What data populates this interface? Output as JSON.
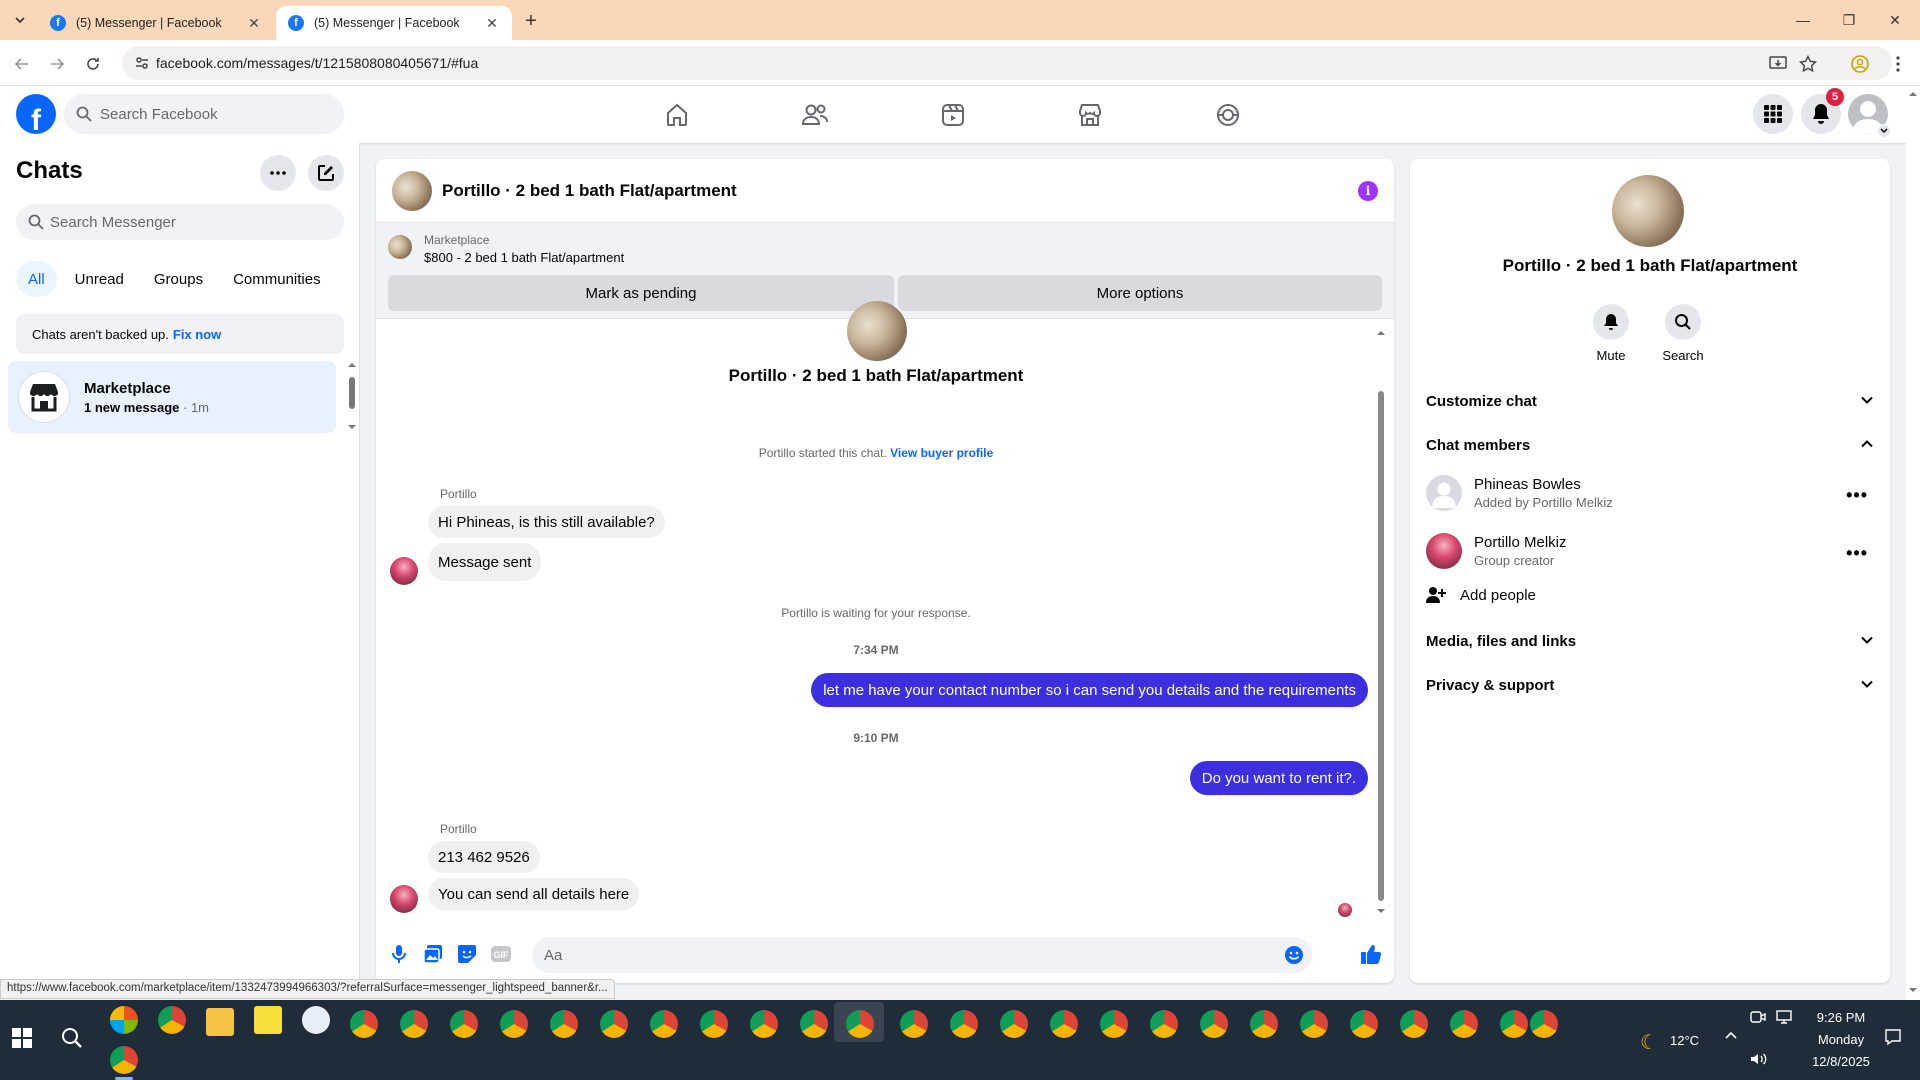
{
  "browser": {
    "tabs": [
      {
        "title": "(5) Messenger | Facebook",
        "favicon": "f"
      },
      {
        "title": "(5) Messenger | Facebook",
        "favicon": "f"
      }
    ],
    "url": "facebook.com/messages/t/1215808080405671/#fua",
    "status_url": "https://www.facebook.com/marketplace/item/1332473994966303/?referralSurface=messenger_lightspeed_banner&r..."
  },
  "fb_header": {
    "search_placeholder": "Search Facebook",
    "notification_count": "5"
  },
  "left": {
    "title": "Chats",
    "search_placeholder": "Search Messenger",
    "filters": [
      "All",
      "Unread",
      "Groups",
      "Communities"
    ],
    "backup_text": "Chats aren't backed up.",
    "backup_link": "Fix now",
    "chat": {
      "name": "Marketplace",
      "unread": "1 new message",
      "time": "· 1m"
    }
  },
  "conversation": {
    "title": "Portillo · 2 bed 1 bath Flat/apartment",
    "marketplace_label": "Marketplace",
    "listing": "$800 - 2 bed 1 bath Flat/apartment",
    "mark_pending": "Mark as pending",
    "more_options": "More options",
    "center_name": "Portillo · 2 bed 1 bath Flat/apartment",
    "started_text": "Portillo started this chat.",
    "buyer_link": "View buyer profile",
    "sender1": "Portillo",
    "msg1": "Hi Phineas, is this still available?",
    "msg2": "Message sent",
    "waiting": "Portillo is waiting for your response.",
    "time1": "7:34 PM",
    "out1": "let me have your contact number so i can send you details and the requirements",
    "time2": "9:10 PM",
    "out2": "Do you want to rent it?.",
    "sender2": "Portillo",
    "msg3": "213 462 9526",
    "msg4": "You can send all details here",
    "composer_placeholder": "Aa"
  },
  "right": {
    "name": "Portillo · 2 bed 1 bath Flat/apartment",
    "mute": "Mute",
    "search": "Search",
    "customize": "Customize chat",
    "members_title": "Chat members",
    "members": [
      {
        "name": "Phineas Bowles",
        "sub": "Added by Portillo Melkiz"
      },
      {
        "name": "Portillo Melkiz",
        "sub": "Group creator"
      }
    ],
    "add_people": "Add people",
    "media": "Media, files and links",
    "privacy": "Privacy & support"
  },
  "taskbar": {
    "weather": "12°C",
    "time": "9:26 PM",
    "day": "Monday",
    "date": "12/8/2025"
  },
  "colors": {
    "fb_blue": "#0866ff",
    "outgoing_bubble": "#3b2fe0",
    "tabbar": "#f9d7b8"
  }
}
